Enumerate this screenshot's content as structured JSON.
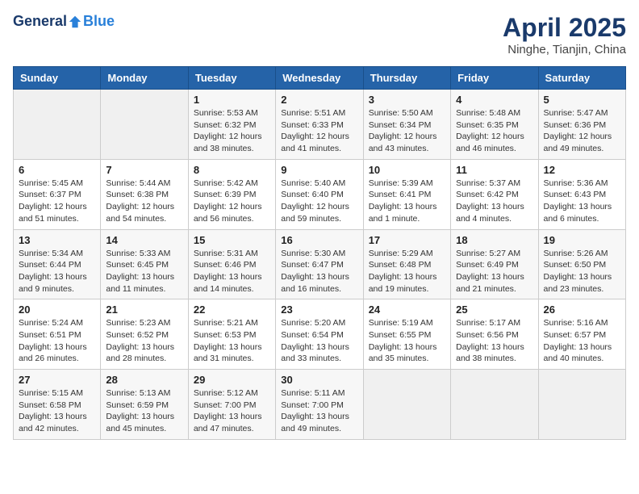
{
  "header": {
    "logo_general": "General",
    "logo_blue": "Blue",
    "month": "April 2025",
    "location": "Ninghe, Tianjin, China"
  },
  "weekdays": [
    "Sunday",
    "Monday",
    "Tuesday",
    "Wednesday",
    "Thursday",
    "Friday",
    "Saturday"
  ],
  "weeks": [
    [
      {
        "day": "",
        "info": ""
      },
      {
        "day": "",
        "info": ""
      },
      {
        "day": "1",
        "info": "Sunrise: 5:53 AM\nSunset: 6:32 PM\nDaylight: 12 hours and 38 minutes."
      },
      {
        "day": "2",
        "info": "Sunrise: 5:51 AM\nSunset: 6:33 PM\nDaylight: 12 hours and 41 minutes."
      },
      {
        "day": "3",
        "info": "Sunrise: 5:50 AM\nSunset: 6:34 PM\nDaylight: 12 hours and 43 minutes."
      },
      {
        "day": "4",
        "info": "Sunrise: 5:48 AM\nSunset: 6:35 PM\nDaylight: 12 hours and 46 minutes."
      },
      {
        "day": "5",
        "info": "Sunrise: 5:47 AM\nSunset: 6:36 PM\nDaylight: 12 hours and 49 minutes."
      }
    ],
    [
      {
        "day": "6",
        "info": "Sunrise: 5:45 AM\nSunset: 6:37 PM\nDaylight: 12 hours and 51 minutes."
      },
      {
        "day": "7",
        "info": "Sunrise: 5:44 AM\nSunset: 6:38 PM\nDaylight: 12 hours and 54 minutes."
      },
      {
        "day": "8",
        "info": "Sunrise: 5:42 AM\nSunset: 6:39 PM\nDaylight: 12 hours and 56 minutes."
      },
      {
        "day": "9",
        "info": "Sunrise: 5:40 AM\nSunset: 6:40 PM\nDaylight: 12 hours and 59 minutes."
      },
      {
        "day": "10",
        "info": "Sunrise: 5:39 AM\nSunset: 6:41 PM\nDaylight: 13 hours and 1 minute."
      },
      {
        "day": "11",
        "info": "Sunrise: 5:37 AM\nSunset: 6:42 PM\nDaylight: 13 hours and 4 minutes."
      },
      {
        "day": "12",
        "info": "Sunrise: 5:36 AM\nSunset: 6:43 PM\nDaylight: 13 hours and 6 minutes."
      }
    ],
    [
      {
        "day": "13",
        "info": "Sunrise: 5:34 AM\nSunset: 6:44 PM\nDaylight: 13 hours and 9 minutes."
      },
      {
        "day": "14",
        "info": "Sunrise: 5:33 AM\nSunset: 6:45 PM\nDaylight: 13 hours and 11 minutes."
      },
      {
        "day": "15",
        "info": "Sunrise: 5:31 AM\nSunset: 6:46 PM\nDaylight: 13 hours and 14 minutes."
      },
      {
        "day": "16",
        "info": "Sunrise: 5:30 AM\nSunset: 6:47 PM\nDaylight: 13 hours and 16 minutes."
      },
      {
        "day": "17",
        "info": "Sunrise: 5:29 AM\nSunset: 6:48 PM\nDaylight: 13 hours and 19 minutes."
      },
      {
        "day": "18",
        "info": "Sunrise: 5:27 AM\nSunset: 6:49 PM\nDaylight: 13 hours and 21 minutes."
      },
      {
        "day": "19",
        "info": "Sunrise: 5:26 AM\nSunset: 6:50 PM\nDaylight: 13 hours and 23 minutes."
      }
    ],
    [
      {
        "day": "20",
        "info": "Sunrise: 5:24 AM\nSunset: 6:51 PM\nDaylight: 13 hours and 26 minutes."
      },
      {
        "day": "21",
        "info": "Sunrise: 5:23 AM\nSunset: 6:52 PM\nDaylight: 13 hours and 28 minutes."
      },
      {
        "day": "22",
        "info": "Sunrise: 5:21 AM\nSunset: 6:53 PM\nDaylight: 13 hours and 31 minutes."
      },
      {
        "day": "23",
        "info": "Sunrise: 5:20 AM\nSunset: 6:54 PM\nDaylight: 13 hours and 33 minutes."
      },
      {
        "day": "24",
        "info": "Sunrise: 5:19 AM\nSunset: 6:55 PM\nDaylight: 13 hours and 35 minutes."
      },
      {
        "day": "25",
        "info": "Sunrise: 5:17 AM\nSunset: 6:56 PM\nDaylight: 13 hours and 38 minutes."
      },
      {
        "day": "26",
        "info": "Sunrise: 5:16 AM\nSunset: 6:57 PM\nDaylight: 13 hours and 40 minutes."
      }
    ],
    [
      {
        "day": "27",
        "info": "Sunrise: 5:15 AM\nSunset: 6:58 PM\nDaylight: 13 hours and 42 minutes."
      },
      {
        "day": "28",
        "info": "Sunrise: 5:13 AM\nSunset: 6:59 PM\nDaylight: 13 hours and 45 minutes."
      },
      {
        "day": "29",
        "info": "Sunrise: 5:12 AM\nSunset: 7:00 PM\nDaylight: 13 hours and 47 minutes."
      },
      {
        "day": "30",
        "info": "Sunrise: 5:11 AM\nSunset: 7:00 PM\nDaylight: 13 hours and 49 minutes."
      },
      {
        "day": "",
        "info": ""
      },
      {
        "day": "",
        "info": ""
      },
      {
        "day": "",
        "info": ""
      }
    ]
  ]
}
